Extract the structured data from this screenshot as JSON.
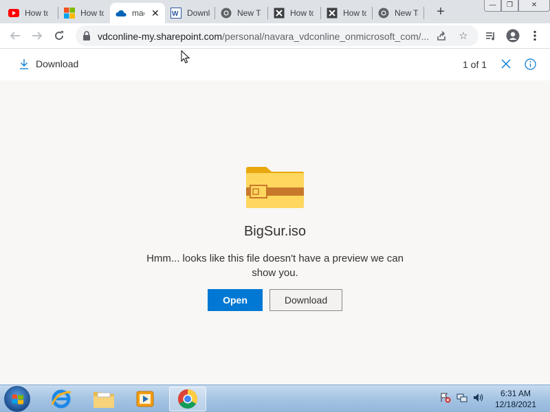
{
  "browser": {
    "tabs": [
      {
        "title": "How to Install macOS Big Sur on VirtualBox on Windows",
        "icon": "youtube-icon"
      },
      {
        "title": "How to Install macOS Big Sur on VirtualBox on Windows",
        "icon": "microsoft-icon"
      },
      {
        "title": "macOS Big Sur - OneDrive",
        "icon": "onedrive-icon",
        "active": true
      },
      {
        "title": "Download macOS Big Sur ISO",
        "icon": "document-icon"
      },
      {
        "title": "New Tab",
        "icon": "chrome-icon"
      },
      {
        "title": "How to Install macOS Big Sur on VirtualBox",
        "icon": "x-icon"
      },
      {
        "title": "How to Install macOS Big Sur on VirtualBox",
        "icon": "x-icon"
      },
      {
        "title": "New Tab",
        "icon": "chrome-icon"
      }
    ],
    "url_host": "vdconline-my.sharepoint.com",
    "url_path": "/personal/navara_vdconline_onmicrosoft_com/..."
  },
  "viewer": {
    "download_label": "Download",
    "page_count": "1 of 1"
  },
  "file": {
    "name": "BigSur.iso",
    "message": "Hmm... looks like this file doesn't have a preview we can show you.",
    "open_label": "Open",
    "download_label": "Download"
  },
  "taskbar": {
    "time": "6:31 AM",
    "date": "12/18/2021"
  },
  "colors": {
    "accent": "#0078d4",
    "folder_body": "#ffd75e",
    "folder_band": "#c8782a"
  }
}
